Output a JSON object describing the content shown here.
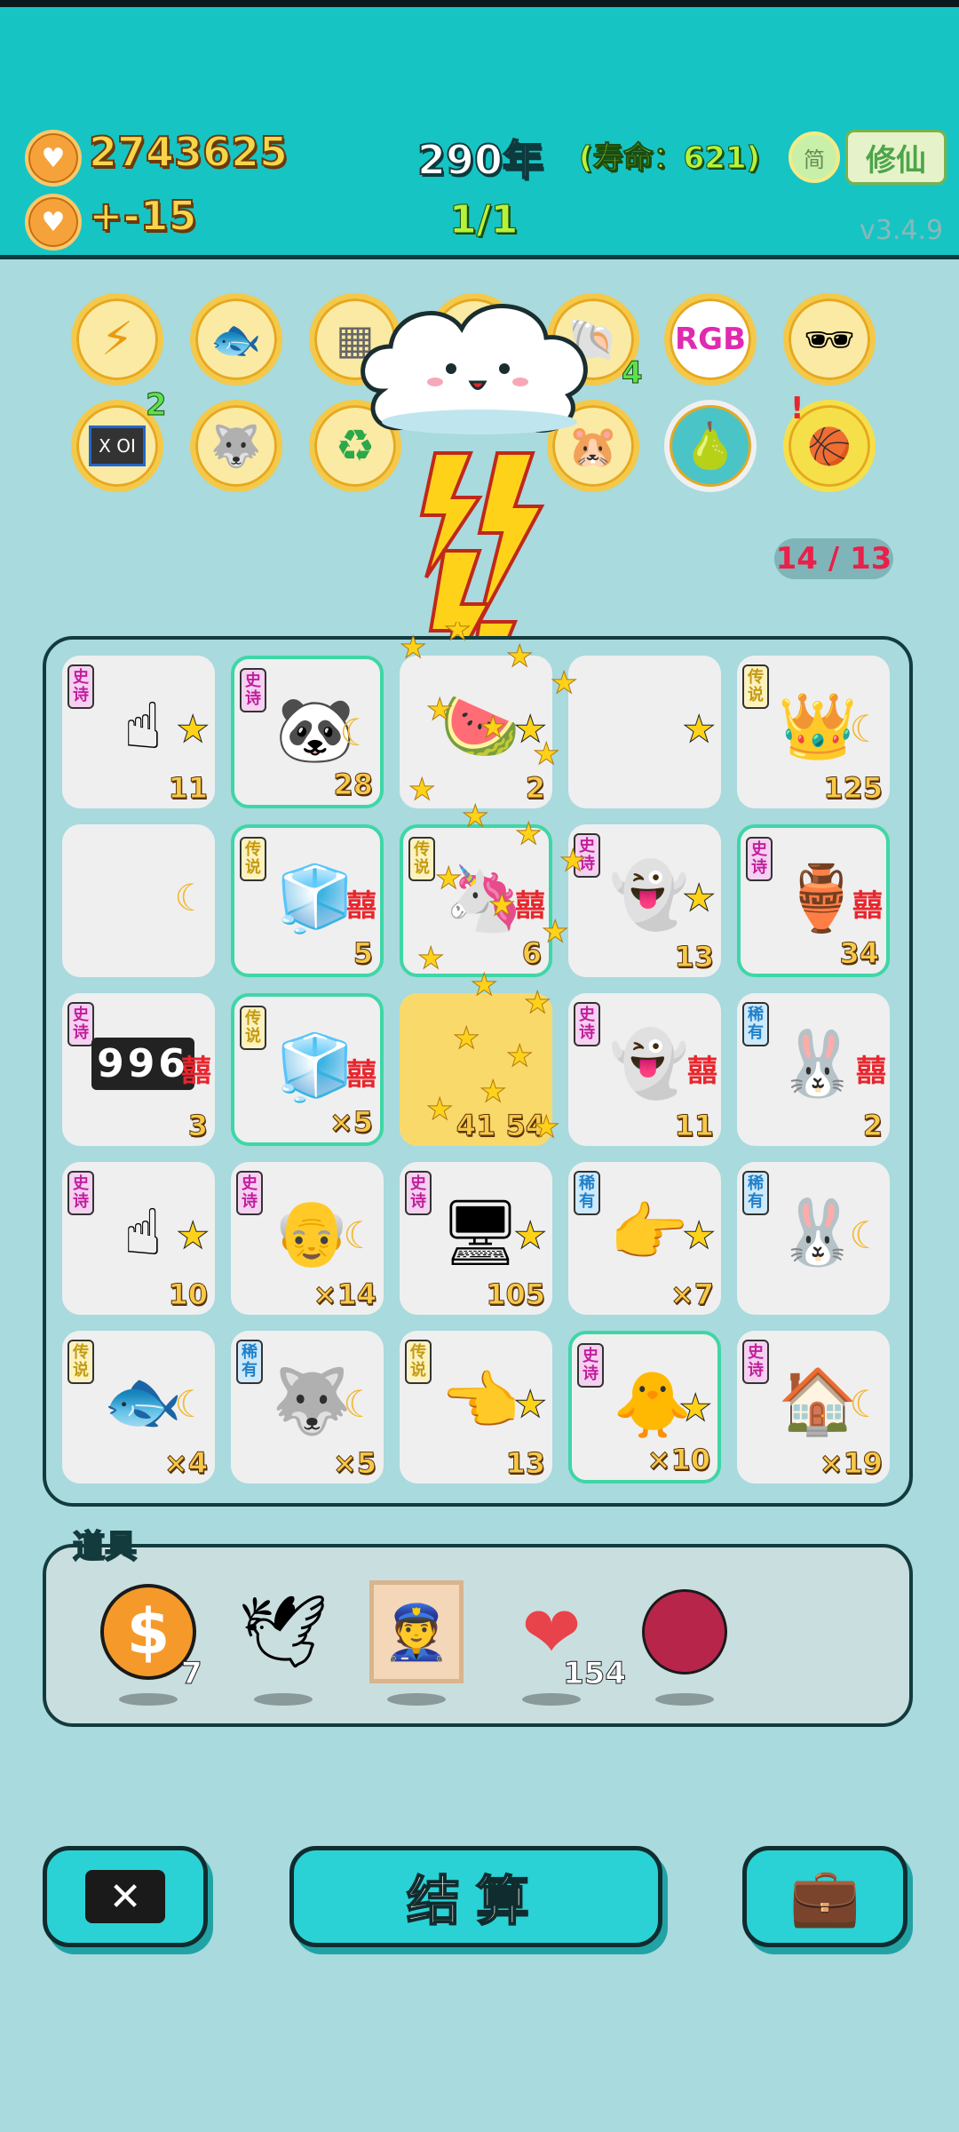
{
  "header": {
    "coins": "2743625",
    "income": "+-15",
    "year": "290年",
    "lifespan": "(寿命：621)",
    "round": "1/1",
    "jian_label": "简",
    "xiuxian_label": "修仙",
    "version": "v3.4.9"
  },
  "relics": [
    {
      "name": "lightning",
      "badge": ""
    },
    {
      "name": "fishbowl",
      "badge": ""
    },
    {
      "name": "skirt",
      "badge": ""
    },
    {
      "name": "hidden",
      "badge": ""
    },
    {
      "name": "shell",
      "badge": "4"
    },
    {
      "name": "rgb",
      "badge": ""
    },
    {
      "name": "sunglasses-ball",
      "badge": ""
    },
    {
      "name": "chip",
      "badge": "2"
    },
    {
      "name": "husky",
      "badge": ""
    },
    {
      "name": "recycle",
      "badge": ""
    },
    {
      "name": "hidden2",
      "badge": ""
    },
    {
      "name": "hamsters",
      "badge": ""
    },
    {
      "name": "pomelo",
      "badge": ""
    },
    {
      "name": "basketballs",
      "badge": ""
    }
  ],
  "rgb_label": "RGB",
  "chip_label": "X OI",
  "counter": "14 / 13",
  "board": [
    {
      "tag": "史诗",
      "tagType": "shi",
      "item": "hand",
      "mod": "star",
      "num": "11",
      "hl": false
    },
    {
      "tag": "史诗",
      "tagType": "shi",
      "item": "panda",
      "mod": "moon",
      "num": "28",
      "hl": true
    },
    {
      "tag": "",
      "tagType": "",
      "item": "watermelon",
      "mod": "star",
      "num": "2",
      "hl": false
    },
    {
      "tag": "",
      "tagType": "",
      "item": "",
      "mod": "star",
      "num": "",
      "hl": false
    },
    {
      "tag": "传说",
      "tagType": "chuan",
      "item": "husky-king",
      "mod": "moon",
      "num": "125",
      "hl": false
    },
    {
      "tag": "",
      "tagType": "",
      "item": "",
      "mod": "moon",
      "num": "",
      "hl": false
    },
    {
      "tag": "传说",
      "tagType": "chuan",
      "item": "fridge",
      "mod": "xi",
      "num": "5",
      "hl": true
    },
    {
      "tag": "传说",
      "tagType": "chuan",
      "item": "unicorn",
      "mod": "xi",
      "num": "6",
      "hl": true
    },
    {
      "tag": "史诗",
      "tagType": "shi",
      "item": "ghost",
      "mod": "star",
      "num": "13",
      "hl": false
    },
    {
      "tag": "史诗",
      "tagType": "shi",
      "item": "calabash",
      "mod": "xi",
      "num": "34",
      "hl": true
    },
    {
      "tag": "史诗",
      "tagType": "shi",
      "item": "996",
      "mod": "xi",
      "num": "3",
      "hl": false
    },
    {
      "tag": "传说",
      "tagType": "chuan",
      "item": "fridge",
      "mod": "xi",
      "num": "×5",
      "hl": true
    },
    {
      "tag": "",
      "tagType": "",
      "item": "stars",
      "mod": "",
      "num": "41 54",
      "hl": false
    },
    {
      "tag": "史诗",
      "tagType": "shi",
      "item": "ghost",
      "mod": "xi",
      "num": "11",
      "hl": false
    },
    {
      "tag": "稀有",
      "tagType": "xi",
      "item": "rabbit",
      "mod": "xi",
      "num": "2",
      "hl": false
    },
    {
      "tag": "史诗",
      "tagType": "shi",
      "item": "hand",
      "mod": "star",
      "num": "10",
      "hl": false
    },
    {
      "tag": "史诗",
      "tagType": "shi",
      "item": "grandpa",
      "mod": "moon",
      "num": "×14",
      "hl": false
    },
    {
      "tag": "史诗",
      "tagType": "shi",
      "item": "gpu",
      "mod": "star",
      "num": "105",
      "hl": false
    },
    {
      "tag": "稀有",
      "tagType": "xi",
      "item": "brown-hand",
      "mod": "star",
      "num": "×7",
      "hl": false
    },
    {
      "tag": "稀有",
      "tagType": "xi",
      "item": "rabbit",
      "mod": "moon",
      "num": "",
      "hl": false
    },
    {
      "tag": "传说",
      "tagType": "chuan",
      "item": "koi",
      "mod": "moon",
      "num": "×4",
      "hl": false
    },
    {
      "tag": "稀有",
      "tagType": "xi",
      "item": "husky",
      "mod": "moon",
      "num": "×5",
      "hl": false
    },
    {
      "tag": "传说",
      "tagType": "chuan",
      "item": "yellow-hand",
      "mod": "star",
      "num": "13",
      "hl": false
    },
    {
      "tag": "史诗",
      "tagType": "shi",
      "item": "bird-grandpa",
      "mod": "star",
      "num": "×10",
      "hl": true
    },
    {
      "tag": "史诗",
      "tagType": "shi",
      "item": "rabbit-house",
      "mod": "moon",
      "num": "×19",
      "hl": false
    }
  ],
  "num_996": "996",
  "xi_char": "囍",
  "tools_title": "道具",
  "tools": [
    {
      "name": "dollar-coin",
      "count": "7"
    },
    {
      "name": "white-bird",
      "count": ""
    },
    {
      "name": "portrait",
      "count": ""
    },
    {
      "name": "liver",
      "count": "154"
    },
    {
      "name": "lychee",
      "count": ""
    }
  ],
  "buttons": {
    "settle": "结算"
  },
  "colors": {
    "topbar": "#17c4c4",
    "background": "#a8dade",
    "button": "#2ad2d6",
    "highlight": "#3fd6a6"
  }
}
